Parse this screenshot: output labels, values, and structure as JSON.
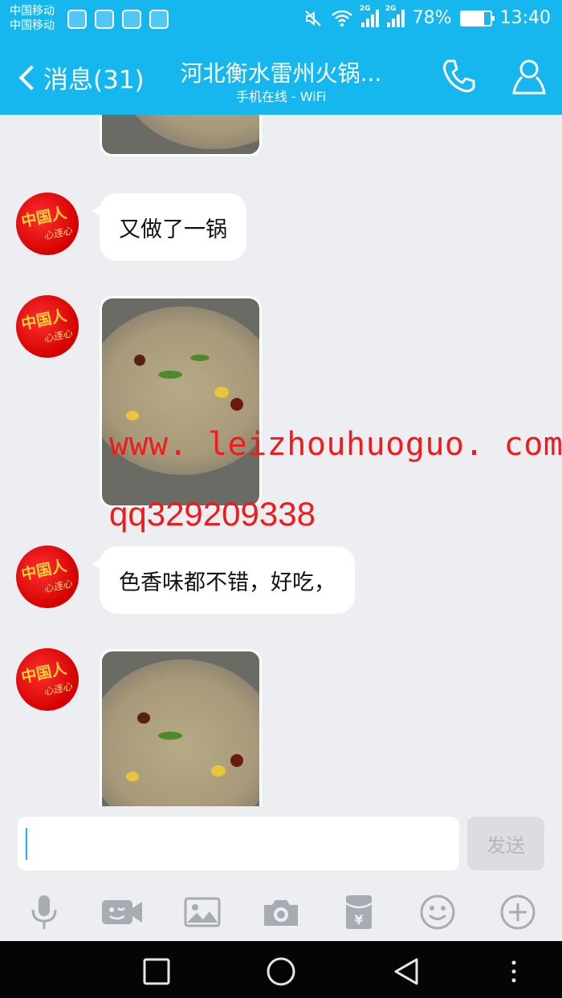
{
  "status_bar": {
    "carrier_1": "中国移动",
    "carrier_2": "中国移动",
    "network_1": "2G",
    "network_2": "2G",
    "battery": "78%",
    "battery_level": 0.78,
    "time": "13:40",
    "apps": [
      "browser-icon",
      "heart-app-icon",
      "news-app-icon",
      "gallery-app-icon"
    ]
  },
  "header": {
    "back_label": "消息(31)",
    "title": "河北衡水雷州火锅...",
    "subtitle": "手机在线 - WiFi",
    "icons": [
      "phone-icon",
      "profile-icon"
    ]
  },
  "messages": [
    {
      "type": "image",
      "content": "hotpot photo (partial)"
    },
    {
      "type": "text",
      "text": "又做了一锅"
    },
    {
      "type": "image",
      "content": "hotpot photo"
    },
    {
      "type": "text",
      "text": "色香味都不错，好吃，"
    },
    {
      "type": "image",
      "content": "hotpot photo"
    }
  ],
  "watermark": {
    "url": "www. leizhouhuoguo. com",
    "qq": "qq329209338"
  },
  "avatar": {
    "text": "中国人",
    "subtext": "心连心"
  },
  "input": {
    "value": "",
    "send_label": "发送"
  },
  "toolbar": [
    "microphone-icon",
    "video-call-icon",
    "image-icon",
    "camera-icon",
    "red-packet-icon",
    "emoji-icon",
    "plus-icon"
  ],
  "navbar": [
    "square-icon",
    "home-circle-icon",
    "back-triangle-icon",
    "menu-dots-icon"
  ],
  "colors": {
    "accent": "#16b6ef",
    "watermark": "#ee1c1c",
    "background": "#eceef2",
    "avatar": "#d40000"
  }
}
